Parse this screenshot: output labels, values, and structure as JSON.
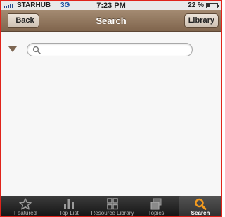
{
  "status_bar": {
    "carrier": "STARHUB",
    "network": "3G",
    "time": "7:23 PM",
    "battery_percent": "22 %",
    "battery_level": 0.22,
    "signal_bars": 5
  },
  "nav": {
    "title": "Search",
    "back_label": "Back",
    "library_label": "Library"
  },
  "search": {
    "value": "",
    "placeholder": "",
    "toggle_icon": "triangle-down-icon",
    "search_icon": "magnifier-icon"
  },
  "tabs": [
    {
      "label": "Featured",
      "icon": "star-icon",
      "active": false
    },
    {
      "label": "Top List",
      "icon": "bar-chart-icon",
      "active": false
    },
    {
      "label": "Resource Library",
      "icon": "grid-icon",
      "active": false
    },
    {
      "label": "Topics",
      "icon": "stack-icon",
      "active": false
    },
    {
      "label": "Search",
      "icon": "magnifier-icon",
      "active": true
    }
  ],
  "colors": {
    "nav_bar": "#8c7058",
    "active_tab_icon": "#f39a1e",
    "frame_border": "#e0241b"
  }
}
